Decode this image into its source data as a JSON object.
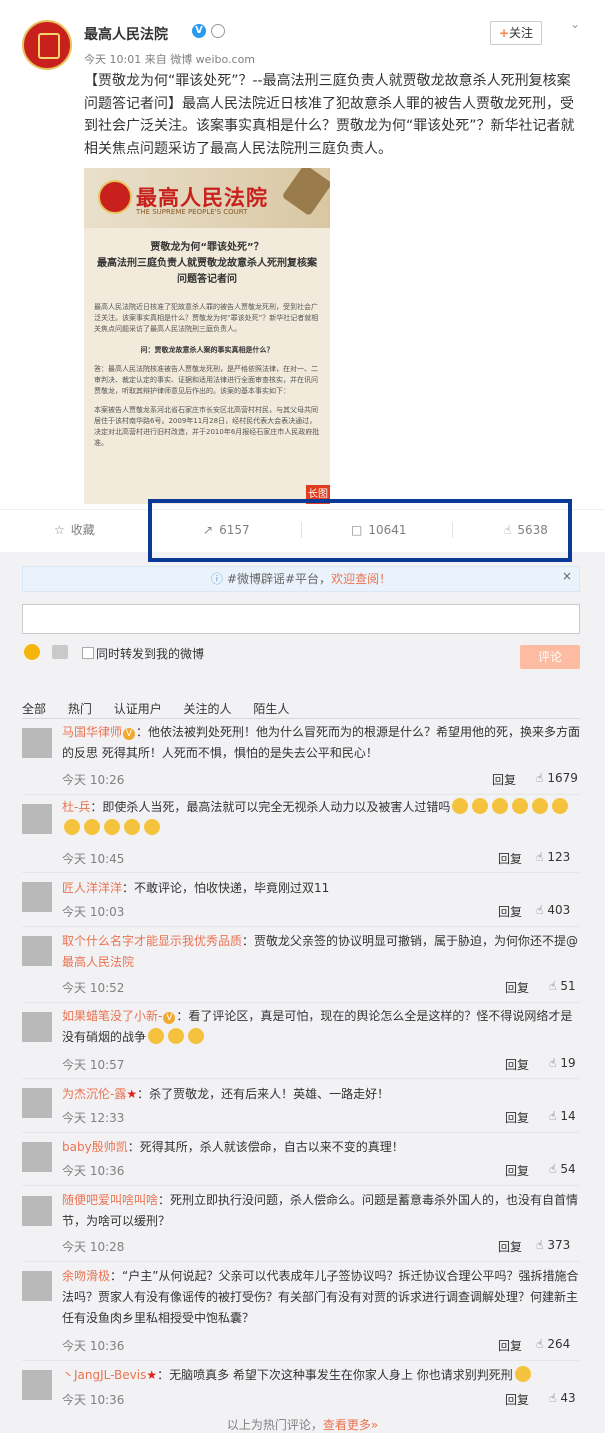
{
  "post": {
    "author": "最高人民法院",
    "verified": "V",
    "meta": "今天 10:01 来自 微博 weibo.com",
    "follow_plus": "+",
    "follow_label": "关注",
    "content": "【贾敬龙为何“罪该处死”？--最高法刑三庭负责人就贾敬龙故意杀人死刑复核案问题答记者问】最高人民法院近日核准了犯故意杀人罪的被告人贾敬龙死刑，受到社会广泛关注。该案事实真相是什么？贾敬龙为何“罪该处死”？新华社记者就相关焦点问题采访了最高人民法院刑三庭负责人。",
    "poster": {
      "title": "最高人民法院",
      "title_en": "THE SUPREME PEOPLE'S COURT",
      "headline": "贾敬龙为何“罪该处死”？\n最高法刑三庭负责人就贾敬龙故意杀人死刑复核案\n问题答记者问",
      "para1": "最高人民法院近日核准了犯故意杀人罪的被告人贾敬龙死刑，受到社会广泛关注。该案事实真相是什么？贾敬龙为何“罪该处死”？新华社记者就相关焦点问题采访了最高人民法院刑三庭负责人。",
      "question": "问：贾敬龙故意杀人案的事实真相是什么？",
      "para2": "答：最高人民法院核准被告人贾敬龙死刑，是严格依照法律，在对一、二审判决、裁定认定的事实、证据和适用法律进行全面审查核实，并在讯问贾敬龙，听取其辩护律师意见后作出的。该案的基本事实如下：",
      "para3": "本案被告人贾敬龙系河北省石家庄市长安区北高营村村民，与其父母共同居住于该村南华路6号。2009年11月28日，经村民代表大会表决通过，决定对北高营村进行旧村改造，并于2010年6月报经石家庄市人民政府批准。",
      "tag": "长图"
    },
    "actions": {
      "favorite": "收藏",
      "repost": "6157",
      "comment": "10641",
      "like": "5638"
    }
  },
  "comment_box": {
    "rumor_prefix": "#微博辟谣#平台，",
    "rumor_link": "欢迎查阅！",
    "close": "×",
    "repost_label": "同时转发到我的微博",
    "submit": "评论"
  },
  "filters": [
    "全部",
    "热门",
    "认证用户",
    "关注的人",
    "陌生人"
  ],
  "comments": [
    {
      "name": "马国华律师",
      "text": "：他依法被判处死刑！他为什么冒死而为的根源是什么？希望用他的死，换来多方面的反思 死得其所！人死而不惧，惧怕的是失去公平和民心！",
      "time": "今天 10:26",
      "reply": "回复",
      "likes": "1679"
    },
    {
      "name": "杜-兵",
      "text": "：即使杀人当死，最高法就可以完全无视杀人动力以及被害人过错吗",
      "time": "今天 10:45",
      "reply": "回复",
      "likes": "123"
    },
    {
      "name": "匠人洋洋洋",
      "text": "：不敢评论，怕收快递，毕竟刚过双11",
      "time": "今天 10:03",
      "reply": "回复",
      "likes": "403"
    },
    {
      "name": "取个什么名字才能显示我优秀品质",
      "text": "：贾敬龙父亲签的协议明显可撤销，属于胁迫，为何你还不提@",
      "mention": "最高人民法院",
      "time": "今天 10:52",
      "reply": "回复",
      "likes": "51"
    },
    {
      "name": "如果蜡笔没了小新-",
      "text": "：看了评论区，真是可怕，现在的舆论怎么全是这样的？怪不得说网络才是没有硝烟的战争",
      "time": "今天 10:57",
      "reply": "回复",
      "likes": "19"
    },
    {
      "name": "为杰沉伦-露",
      "text": "：杀了贾敬龙，还有后来人！英雄、一路走好！",
      "time": "今天 12:33",
      "reply": "回复",
      "likes": "14"
    },
    {
      "name": "baby殷帅凯",
      "text": "：死得其所，杀人就该偿命，自古以来不变的真理！",
      "time": "今天 10:36",
      "reply": "回复",
      "likes": "54"
    },
    {
      "name": "随便吧爱叫啥叫啥",
      "text": "：死刑立即执行没问题，杀人偿命么。问题是蓄意毒杀外国人的，也没有自首情节，为啥可以缓刑？",
      "time": "今天 10:28",
      "reply": "回复",
      "likes": "373"
    },
    {
      "name": "余吻滑极",
      "text": "：“户主”从何说起？父亲可以代表成年儿子签协议吗？拆迁协议合理公平吗？强拆措施合法吗？贾家人有没有像谣传的被打受伤？有关部门有没有对贾的诉求进行调查调解处理？何建新主任有没鱼肉乡里私相授受中饱私囊？",
      "time": "今天 10:36",
      "reply": "回复",
      "likes": "264"
    },
    {
      "name": "丶JangJL-Bevis",
      "text": "：无脑喷真多 希望下次这种事发生在你家人身上 你也请求别判死刑",
      "time": "今天 10:36",
      "reply": "回复",
      "likes": "43"
    }
  ],
  "footer": {
    "prefix": "以上为热门评论，",
    "link": "查看更多»"
  },
  "colors": {
    "link": "#eb7350",
    "highlight": "#0a3a96",
    "verified": "#2a9bec"
  }
}
